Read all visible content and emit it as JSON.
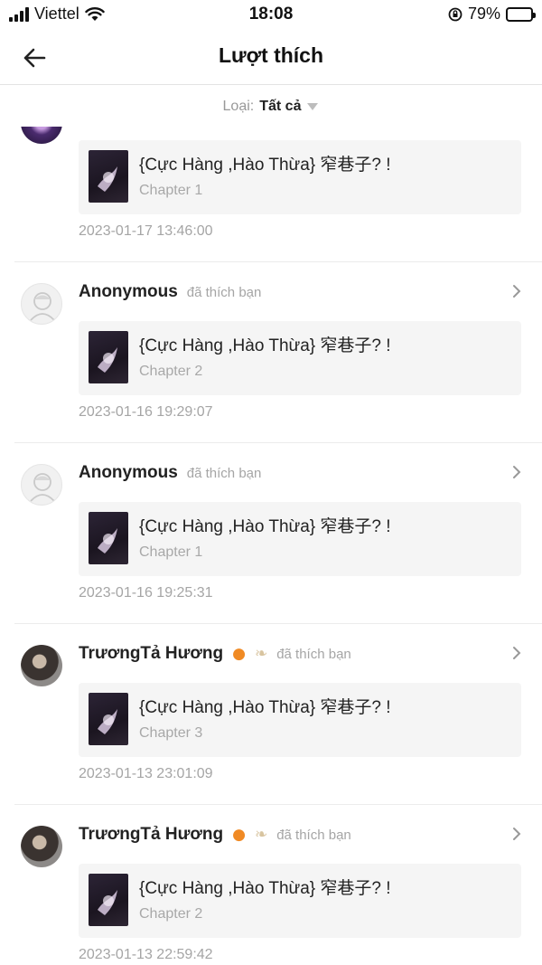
{
  "status_bar": {
    "carrier": "Viettel",
    "time": "18:08",
    "battery": "79%",
    "battery_level": 0.79
  },
  "nav": {
    "title": "Lượt thích",
    "back_icon": "arrow-left-icon"
  },
  "filter": {
    "label": "Loại:",
    "value": "Tất cả",
    "icon": "caret-down-icon"
  },
  "items": [
    {
      "username": "",
      "action": "",
      "avatar": "galaxy",
      "book_title": "{Cực Hàng ,Hào Thừa} 窄巷子? !",
      "chapter": "Chapter 1",
      "timestamp": "2023-01-17 13:46:00"
    },
    {
      "username": "Anonymous",
      "action": "đã thích bạn",
      "avatar": "anon",
      "book_title": "{Cực Hàng ,Hào Thừa} 窄巷子? !",
      "chapter": "Chapter 2",
      "timestamp": "2023-01-16 19:29:07"
    },
    {
      "username": "Anonymous",
      "action": "đã thích bạn",
      "avatar": "anon",
      "book_title": "{Cực Hàng ,Hào Thừa} 窄巷子? !",
      "chapter": "Chapter 1",
      "timestamp": "2023-01-16 19:25:31"
    },
    {
      "username": "TrươngTả Hương",
      "emoji": [
        "orange-emoji",
        "leaf-emoji"
      ],
      "action": "đã thích bạn",
      "avatar": "photo",
      "book_title": "{Cực Hàng ,Hào Thừa} 窄巷子? !",
      "chapter": "Chapter 3",
      "timestamp": "2023-01-13 23:01:09"
    },
    {
      "username": "TrươngTả Hương",
      "emoji": [
        "orange-emoji",
        "leaf-emoji"
      ],
      "action": "đã thích bạn",
      "avatar": "photo",
      "book_title": "{Cực Hàng ,Hào Thừa} 窄巷子? !",
      "chapter": "Chapter 2",
      "timestamp": "2023-01-13 22:59:42"
    }
  ]
}
